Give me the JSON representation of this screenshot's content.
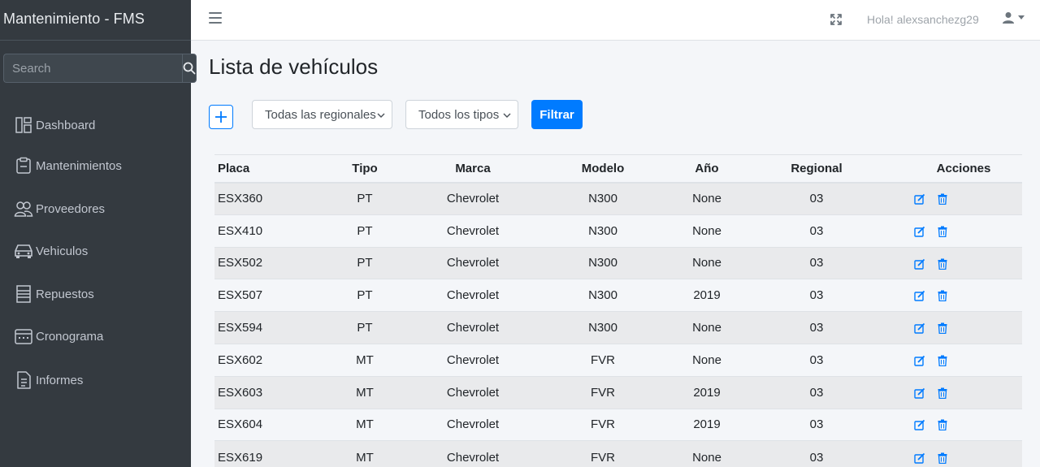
{
  "brand": "Mantenimiento - FMS",
  "search": {
    "placeholder": "Search"
  },
  "nav": [
    {
      "label": "Dashboard",
      "icon": "dashboard-icon"
    },
    {
      "label": "Mantenimientos",
      "icon": "clipboard-icon"
    },
    {
      "label": "Proveedores",
      "icon": "people-icon"
    },
    {
      "label": "Vehiculos",
      "icon": "car-icon"
    },
    {
      "label": "Repuestos",
      "icon": "list-icon"
    },
    {
      "label": "Cronograma",
      "icon": "calendar-icon"
    },
    {
      "label": "Informes",
      "icon": "document-icon"
    }
  ],
  "topbar": {
    "greeting": "Hola! alexsanchezg29"
  },
  "page": {
    "title": "Lista de vehículos",
    "region_select": "Todas las regionales",
    "type_select": "Todos los tipos",
    "filter_button": "Filtrar"
  },
  "table": {
    "headers": [
      "Placa",
      "Tipo",
      "Marca",
      "Modelo",
      "Año",
      "Regional",
      "Acciones"
    ],
    "rows": [
      [
        "ESX360",
        "PT",
        "Chevrolet",
        "N300",
        "None",
        "03"
      ],
      [
        "ESX410",
        "PT",
        "Chevrolet",
        "N300",
        "None",
        "03"
      ],
      [
        "ESX502",
        "PT",
        "Chevrolet",
        "N300",
        "None",
        "03"
      ],
      [
        "ESX507",
        "PT",
        "Chevrolet",
        "N300",
        "2019",
        "03"
      ],
      [
        "ESX594",
        "PT",
        "Chevrolet",
        "N300",
        "None",
        "03"
      ],
      [
        "ESX602",
        "MT",
        "Chevrolet",
        "FVR",
        "None",
        "03"
      ],
      [
        "ESX603",
        "MT",
        "Chevrolet",
        "FVR",
        "2019",
        "03"
      ],
      [
        "ESX604",
        "MT",
        "Chevrolet",
        "FVR",
        "2019",
        "03"
      ],
      [
        "ESX619",
        "MT",
        "Chevrolet",
        "FVR",
        "None",
        "03"
      ]
    ]
  },
  "colors": {
    "sidebar": "#343a40",
    "primary": "#007bff",
    "background": "#f4f6f9"
  }
}
